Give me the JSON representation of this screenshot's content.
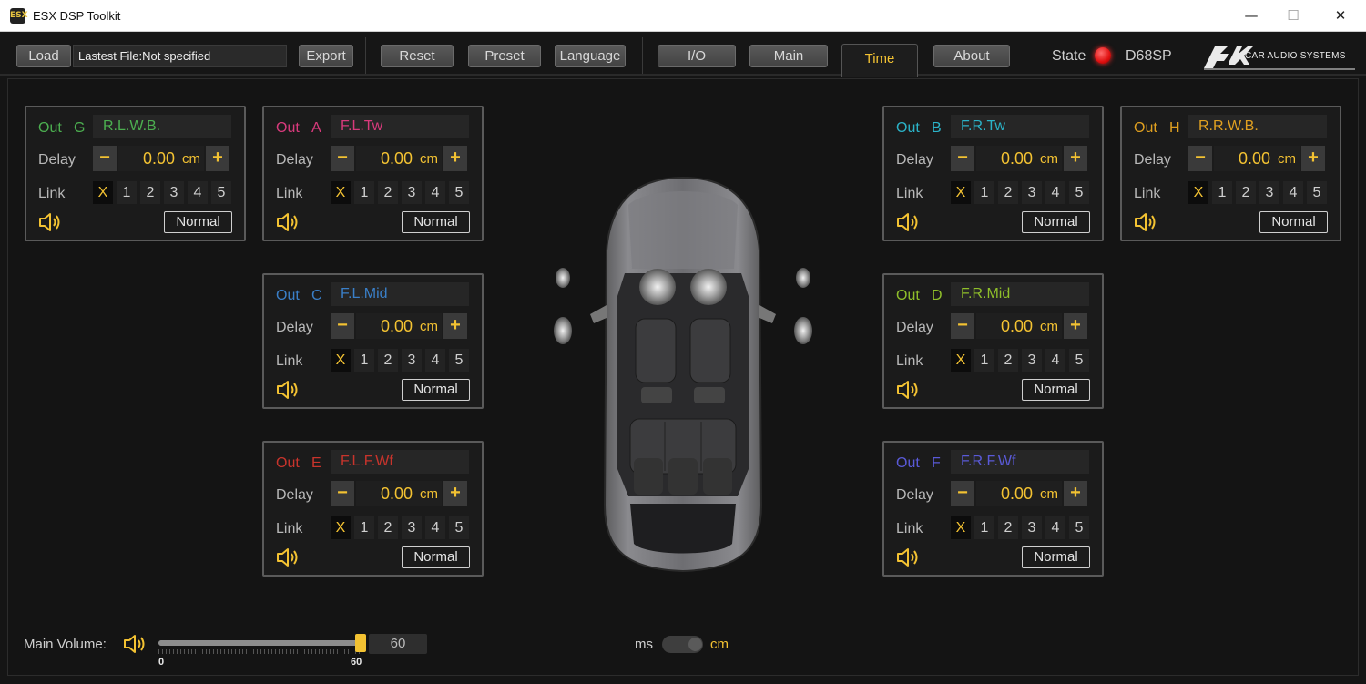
{
  "window": {
    "title": "ESX DSP Toolkit",
    "icon_text": "ESX",
    "controls": [
      "—",
      "☐",
      "✕"
    ]
  },
  "toolbar": {
    "load": "Load",
    "file_label": "Lastest File:Not specified",
    "export": "Export",
    "reset": "Reset",
    "preset": "Preset",
    "language": "Language",
    "tabs": [
      "I/O",
      "Main",
      "Time",
      "About"
    ],
    "active_tab": "Time",
    "state_label": "State",
    "state_color": "#e01010",
    "device": "D68SP",
    "logo_mark": "ESX",
    "logo_text": "CAR AUDIO SYSTEMS"
  },
  "channel_labels": {
    "out": "Out",
    "delay": "Delay",
    "unit": "cm",
    "link": "Link",
    "minus": "−",
    "plus": "+",
    "link_options": [
      "X",
      "1",
      "2",
      "3",
      "4",
      "5"
    ]
  },
  "channels": [
    {
      "letter": "G",
      "name": "R.L.W.B.",
      "delay": "0.00",
      "mode": "Normal",
      "color": "#4caf50"
    },
    {
      "letter": "A",
      "name": "F.L.Tw",
      "delay": "0.00",
      "mode": "Normal",
      "color": "#d83a7c"
    },
    {
      "letter": "B",
      "name": "F.R.Tw",
      "delay": "0.00",
      "mode": "Normal",
      "color": "#2bb3c8"
    },
    {
      "letter": "H",
      "name": "R.R.W.B.",
      "delay": "0.00",
      "mode": "Normal",
      "color": "#e0a020"
    },
    {
      "letter": "C",
      "name": "F.L.Mid",
      "delay": "0.00",
      "mode": "Normal",
      "color": "#3a7fc8"
    },
    {
      "letter": "D",
      "name": "F.R.Mid",
      "delay": "0.00",
      "mode": "Normal",
      "color": "#8fbf2a"
    },
    {
      "letter": "E",
      "name": "F.L.F.Wf",
      "delay": "0.00",
      "mode": "Normal",
      "color": "#c8342c"
    },
    {
      "letter": "F",
      "name": "F.R.F.Wf",
      "delay": "0.00",
      "mode": "Normal",
      "color": "#5a5ad8"
    }
  ],
  "bottom": {
    "main_volume_label": "Main Volume:",
    "volume_value": "60",
    "slider_min": "0",
    "slider_max": "60",
    "volume_fraction": 1.0,
    "unit_ms": "ms",
    "unit_cm": "cm"
  },
  "colors": {
    "accent": "#f3c232",
    "panel_border": "#5a5a5a",
    "background": "#151515"
  }
}
